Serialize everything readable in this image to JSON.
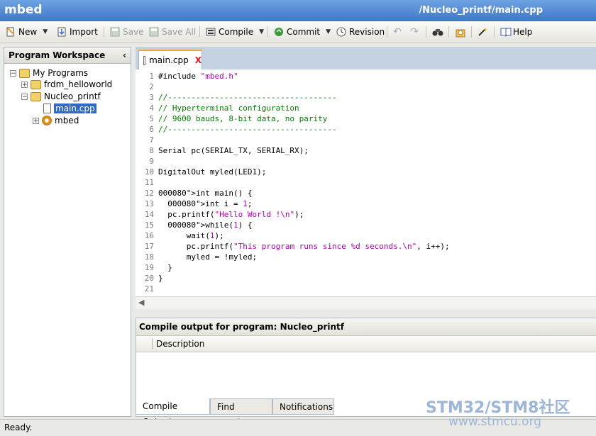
{
  "app": {
    "name": "mbed",
    "path": "/Nucleo_printf/main.cpp"
  },
  "toolbar": {
    "new": "New",
    "import": "Import",
    "save": "Save",
    "save_all": "Save All",
    "compile": "Compile",
    "commit": "Commit",
    "revision": "Revision",
    "help": "Help"
  },
  "workspace": {
    "title": "Program Workspace",
    "root": "My Programs",
    "items": [
      "frdm_helloworld",
      "Nucleo_printf",
      "main.cpp",
      "mbed"
    ]
  },
  "editor": {
    "tab": "main.cpp",
    "tab_close": "X",
    "lines": [
      {
        "n": "1",
        "t": "#include \"mbed.h\""
      },
      {
        "n": "2",
        "t": ""
      },
      {
        "n": "3",
        "t": "//------------------------------------"
      },
      {
        "n": "4",
        "t": "// Hyperterminal configuration"
      },
      {
        "n": "5",
        "t": "// 9600 bauds, 8-bit data, no parity"
      },
      {
        "n": "6",
        "t": "//------------------------------------"
      },
      {
        "n": "7",
        "t": ""
      },
      {
        "n": "8",
        "t": "Serial pc(SERIAL_TX, SERIAL_RX);"
      },
      {
        "n": "9",
        "t": ""
      },
      {
        "n": "10",
        "t": "DigitalOut myled(LED1);"
      },
      {
        "n": "11",
        "t": ""
      },
      {
        "n": "12",
        "t": "int main() {"
      },
      {
        "n": "13",
        "t": "  int i = 1;"
      },
      {
        "n": "14",
        "t": "  pc.printf(\"Hello World !\\n\");"
      },
      {
        "n": "15",
        "t": "  while(1) {"
      },
      {
        "n": "16",
        "t": "      wait(1);"
      },
      {
        "n": "17",
        "t": "      pc.printf(\"This program runs since %d seconds.\\n\", i++);"
      },
      {
        "n": "18",
        "t": "      myled = !myled;"
      },
      {
        "n": "19",
        "t": "  }"
      },
      {
        "n": "20",
        "t": "}"
      },
      {
        "n": "21",
        "t": ""
      }
    ]
  },
  "output": {
    "title": "Compile output for program: Nucleo_printf",
    "column": "Description",
    "tabs": [
      "Compile Output",
      "Find Results",
      "Notifications"
    ]
  },
  "status": "Ready.",
  "watermark": {
    "line1": "STM32/STM8社区",
    "line2": "www.stmcu.org"
  },
  "colors": {
    "title_bar": "#3f76c8",
    "selection": "#316ac5",
    "string": "#b000b0",
    "comment": "#008000",
    "keyword": "#000080",
    "number": "#b000b0"
  },
  "icons": [
    "new-icon",
    "import-icon",
    "save-icon",
    "save-all-icon",
    "compile-icon",
    "commit-icon",
    "revision-icon",
    "undo-icon",
    "redo-icon",
    "find-icon",
    "library-icon",
    "wand-icon",
    "help-book-icon"
  ]
}
